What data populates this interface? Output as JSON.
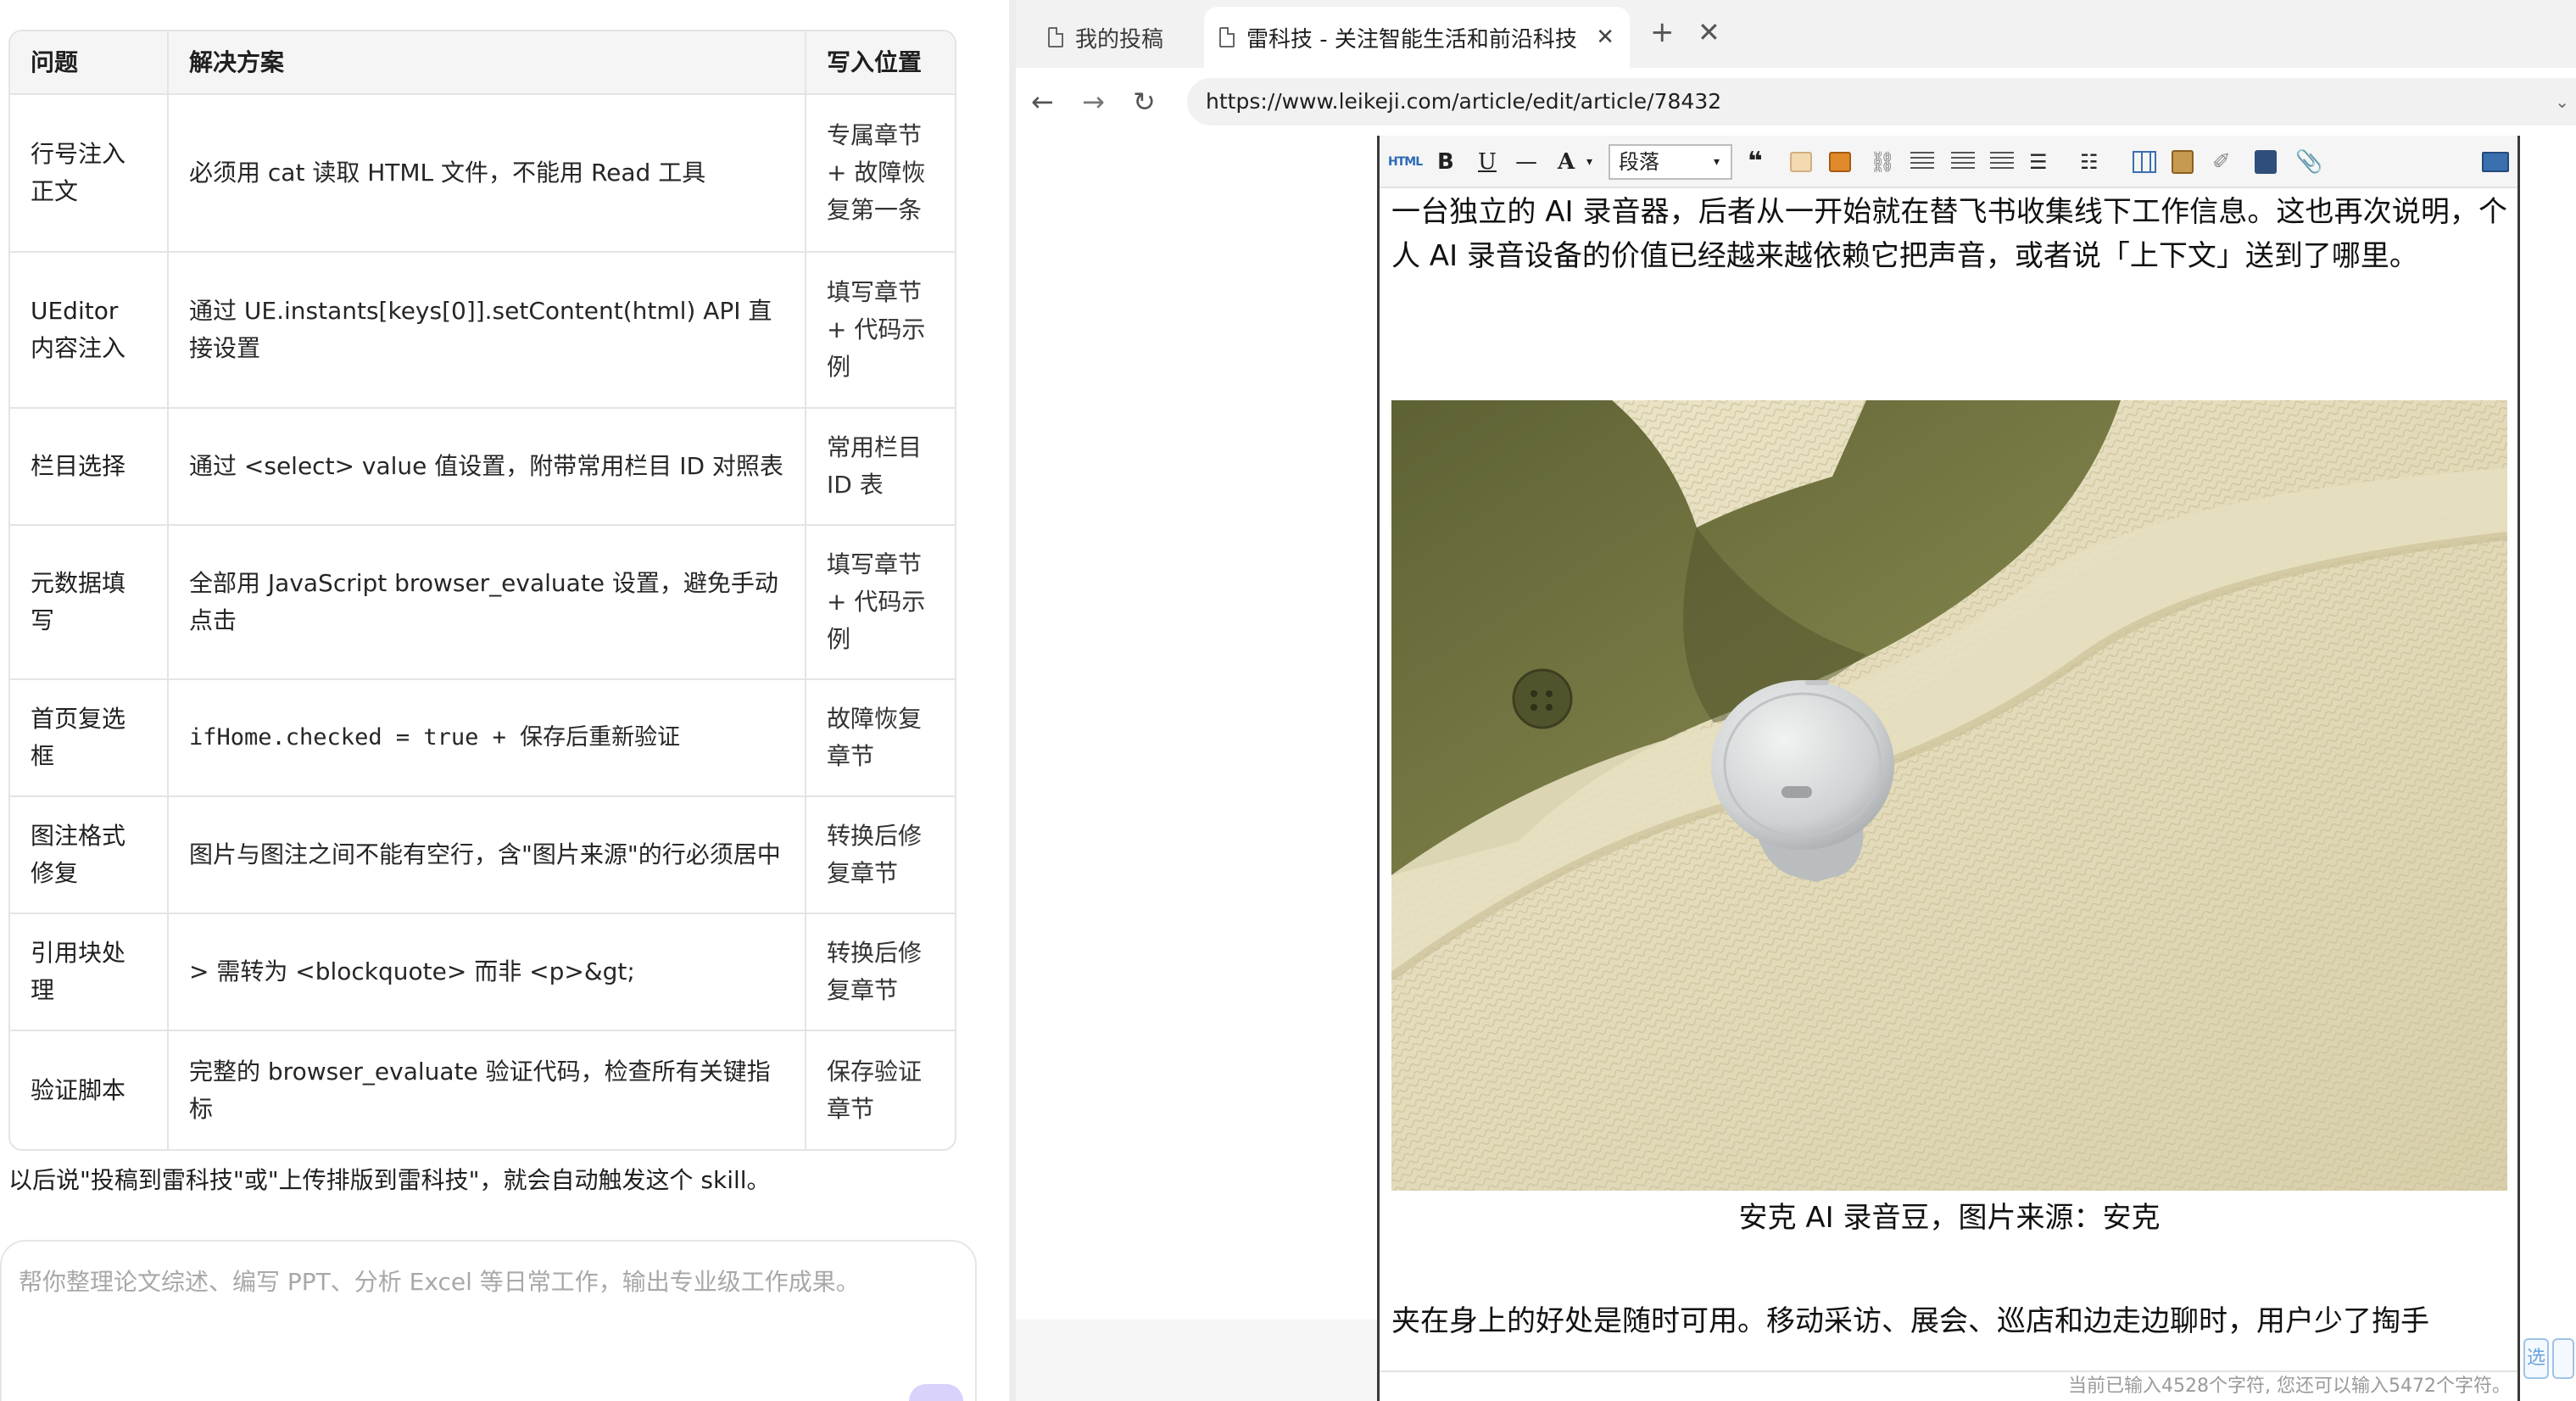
{
  "skill_table": {
    "headers": {
      "problem": "问题",
      "solution": "解决方案",
      "location": "写入位置"
    },
    "rows": [
      {
        "problem": "行号注入正文",
        "solution": "必须用 cat 读取 HTML 文件，不能用 Read 工具",
        "location": "专属章节 + 故障恢复第一条"
      },
      {
        "problem": "UEditor 内容注入",
        "solution": "通过 UE.instants[keys[0]].setContent(html) API 直接设置",
        "location": "填写章节 + 代码示例"
      },
      {
        "problem": "栏目选择",
        "solution": "通过 <select> value 值设置，附带常用栏目 ID 对照表",
        "location": "常用栏目 ID 表"
      },
      {
        "problem": "元数据填写",
        "solution": "全部用 JavaScript browser_evaluate 设置，避免手动点击",
        "location": "填写章节 + 代码示例"
      },
      {
        "problem": "首页复选框",
        "solution": "ifHome.checked = true + 保存后重新验证",
        "location": "故障恢复章节"
      },
      {
        "problem": "图注格式修复",
        "solution": "图片与图注之间不能有空行，含\"图片来源\"的行必须居中",
        "location": "转换后修复章节"
      },
      {
        "problem": "引用块处理",
        "solution": "> 需转为 <blockquote> 而非 <p>&gt;",
        "location": "转换后修复章节"
      },
      {
        "problem": "验证脚本",
        "solution": "完整的 browser_evaluate 验证代码，检查所有关键指标",
        "location": "保存验证章节"
      }
    ]
  },
  "footnote": "以后说\"投稿到雷科技\"或\"上传排版到雷科技\"，就会自动触发这个 skill。",
  "chat": {
    "placeholder": "帮你整理论文综述、编写 PPT、分析 Excel 等日常工作，输出专业级工作成果。",
    "send_color": "#d9d2fb"
  },
  "browser": {
    "tabs": [
      {
        "title": "我的投稿",
        "active": false
      },
      {
        "title": "雷科技 - 关注智能生活和前沿科技",
        "active": true
      }
    ],
    "tab_close_glyph": "✕",
    "new_tab_glyph": "+",
    "close_window_glyph": "✕",
    "nav": {
      "back_glyph": "←",
      "forward_glyph": "→",
      "reload_glyph": "↻"
    },
    "url": "https://www.leikeji.com/article/edit/article/78432",
    "url_dropdown_glyph": "⌄"
  },
  "editor": {
    "toolbar": {
      "html_label": "HTML",
      "bold_label": "B",
      "underline_label": "U",
      "hr_label": "—",
      "fontcolor_label": "A",
      "dropdown_glyph": "▾",
      "paragraph_label": "段落",
      "quote_label": "❝",
      "link_glyph": "⛓",
      "ul_glyph": "☰",
      "ol_glyph": "☷",
      "eraser_glyph": "✐",
      "attach_glyph": "📎"
    },
    "paragraph_1": "一台独立的 AI 录音器，后者从一开始就在替飞书收集线下工作信息。这也再次说明，个人 AI 录音设备的价值已经越来越依赖它把声音，或者说「上下文」送到了哪里。",
    "image_caption": "安克 AI 录音豆，图片来源：安克",
    "paragraph_2": "夹在身上的好处是随时可用。移动采访、展会、巡店和边走边聊时，用户少了掏手",
    "status": "当前已输入4528个字符, 您还可以输入5472个字符。",
    "side_widget_label": "选"
  }
}
